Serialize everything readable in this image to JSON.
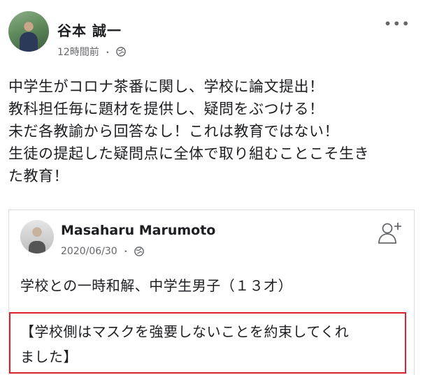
{
  "post": {
    "author": "谷本 誠一",
    "time": "12時間前",
    "separator": "・",
    "privacy_icon": "globe-icon",
    "more_icon": "•••",
    "body_lines": [
      "中学生がコロナ茶番に関し、学校に論文提出！",
      "教科担任毎に題材を提供し、疑問をぶつける！",
      "未だ各教諭から回答なし！これは教育ではない！",
      "生徒の提起した疑問点に全体で取り組むことこそ生き",
      "た教育！"
    ]
  },
  "shared": {
    "author": "Masaharu Marumoto",
    "date": "2020/06/30",
    "separator": "・",
    "privacy_icon": "globe-icon",
    "add_friend_icon": "add-friend-icon",
    "text": "学校との一時和解、中学生男子（１３才）",
    "highlight_lines": [
      "【学校側はマスクを強要しないことを約束してくれ",
      "ました】"
    ]
  },
  "colors": {
    "text": "#1c1e21",
    "meta": "#65676b",
    "highlight_border": "#d9232d",
    "card_border": "#dadde1"
  }
}
